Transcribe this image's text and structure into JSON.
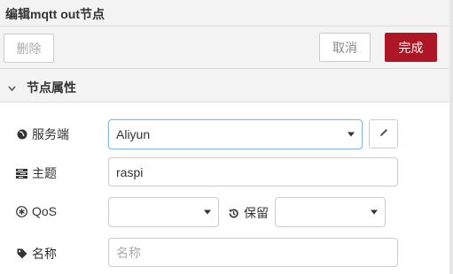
{
  "window": {
    "title": "编辑mqtt out节点"
  },
  "toolbar": {
    "delete_label": "删除",
    "cancel_label": "取消",
    "done_label": "完成"
  },
  "section": {
    "title": "节点属性"
  },
  "form": {
    "server": {
      "label": "服务端",
      "value": "Aliyun"
    },
    "topic": {
      "label": "主题",
      "value": "raspi"
    },
    "qos": {
      "label": "QoS",
      "value": ""
    },
    "retain": {
      "label": "保留",
      "value": ""
    },
    "name": {
      "label": "名称",
      "value": "",
      "placeholder": "名称"
    }
  },
  "colors": {
    "primary": "#ad1625",
    "panel": "#f3f3f3",
    "border": "#cccccc",
    "focus": "#8cb8e0"
  },
  "icons": {
    "server": "globe-icon",
    "topic": "tasks-icon",
    "qos": "asterisk-icon",
    "retain": "history-icon",
    "name": "tag-icon",
    "edit": "pencil-icon"
  }
}
